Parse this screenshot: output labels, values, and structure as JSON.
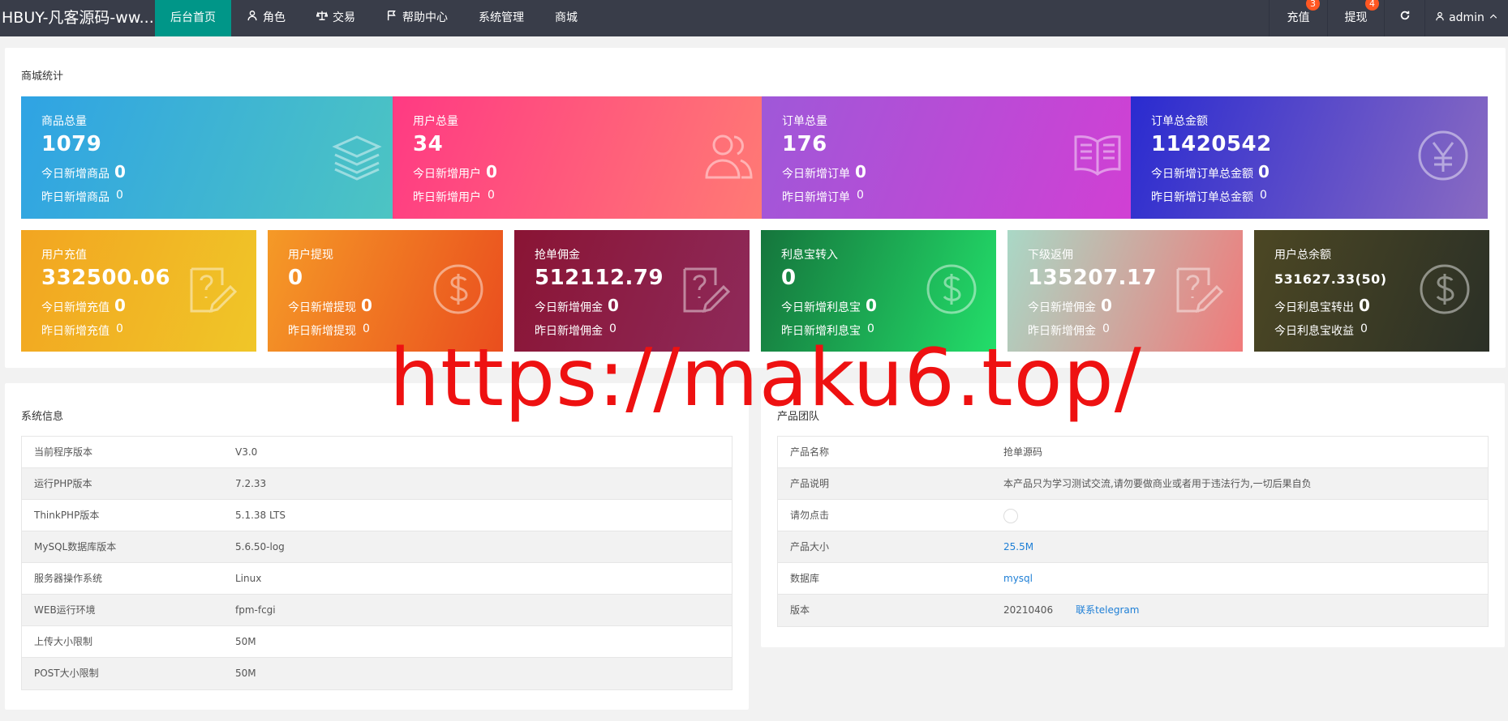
{
  "header": {
    "logo": "HBUY-凡客源码-ww...",
    "nav": [
      {
        "label": "后台首页",
        "icon": "",
        "active": true
      },
      {
        "label": "角色",
        "icon": "user-icon"
      },
      {
        "label": "交易",
        "icon": "scale-icon"
      },
      {
        "label": "帮助中心",
        "icon": "flag-icon"
      },
      {
        "label": "系统管理",
        "icon": ""
      },
      {
        "label": "商城",
        "icon": ""
      }
    ],
    "right": {
      "recharge": {
        "label": "充值",
        "badge": "3"
      },
      "withdraw": {
        "label": "提现",
        "badge": "4"
      },
      "refresh_icon": "refresh-icon",
      "user": {
        "label": "admin",
        "icon": "user-icon",
        "caret": "chevron-up-icon"
      }
    }
  },
  "stats": {
    "title": "商城统计",
    "cards": [
      {
        "label": "商品总量",
        "value": "1079",
        "today_label": "今日新增商品",
        "today": "0",
        "yesterday_label": "昨日新增商品",
        "yesterday": "0",
        "icon": "layers-icon",
        "gradient": [
          "#2fa3e4",
          "#4dc5c2"
        ]
      },
      {
        "label": "用户总量",
        "value": "34",
        "today_label": "今日新增用户",
        "today": "0",
        "yesterday_label": "昨日新增用户",
        "yesterday": "0",
        "icon": "users-icon",
        "gradient": [
          "#ff3a83",
          "#ff7c74"
        ]
      },
      {
        "label": "订单总量",
        "value": "176",
        "today_label": "今日新增订单",
        "today": "0",
        "yesterday_label": "昨日新增订单",
        "yesterday": "0",
        "icon": "book-icon",
        "gradient": [
          "#9f58d8",
          "#d23fd4"
        ]
      },
      {
        "label": "订单总金额",
        "value": "11420542",
        "today_label": "今日新增订单总金额",
        "today": "0",
        "yesterday_label": "昨日新增订单总金额",
        "yesterday": "0",
        "icon": "yen-icon",
        "gradient": [
          "#2a2bd0",
          "#8a6bc2"
        ]
      },
      {
        "label": "用户充值",
        "value": "332500.06",
        "today_label": "今日新增充值",
        "today": "0",
        "yesterday_label": "昨日新增充值",
        "yesterday": "0",
        "icon": "question-edit-icon",
        "gradient": [
          "#f2a521",
          "#f0c628"
        ]
      },
      {
        "label": "用户提现",
        "value": "0",
        "today_label": "今日新增提现",
        "today": "0",
        "yesterday_label": "昨日新增提现",
        "yesterday": "0",
        "icon": "dollar-icon",
        "gradient": [
          "#f59a27",
          "#ea4e1e"
        ]
      },
      {
        "label": "抢单佣金",
        "value": "512112.79",
        "today_label": "今日新增佣金",
        "today": "0",
        "yesterday_label": "昨日新增佣金",
        "yesterday": "0",
        "icon": "question-edit-icon",
        "gradient": [
          "#8a1434",
          "#8e2a5a"
        ]
      },
      {
        "label": "利息宝转入",
        "value": "0",
        "today_label": "今日新增利息宝",
        "today": "0",
        "yesterday_label": "昨日新增利息宝",
        "yesterday": "0",
        "icon": "dollar-icon",
        "gradient": [
          "#15753c",
          "#23de6a"
        ]
      },
      {
        "label": "下级返佣",
        "value": "135207.17",
        "today_label": "今日新增佣金",
        "today": "0",
        "yesterday_label": "昨日新增佣金",
        "yesterday": "0",
        "icon": "question-edit-icon",
        "gradient": [
          "#a9d8c6",
          "#f07a7a"
        ]
      },
      {
        "label": "用户总余额",
        "value": "531627.33(50)",
        "today_label": "今日利息宝转出",
        "today": "0",
        "yesterday_label": "今日利息宝收益",
        "yesterday": "0",
        "icon": "dollar-icon",
        "gradient": [
          "#4c4724",
          "#2b3026"
        ],
        "small": true
      }
    ]
  },
  "system": {
    "title": "系统信息",
    "rows": [
      {
        "k": "当前程序版本",
        "v": "V3.0"
      },
      {
        "k": "运行PHP版本",
        "v": "7.2.33"
      },
      {
        "k": "ThinkPHP版本",
        "v": "5.1.38 LTS"
      },
      {
        "k": "MySQL数据库版本",
        "v": "5.6.50-log"
      },
      {
        "k": "服务器操作系统",
        "v": "Linux"
      },
      {
        "k": "WEB运行环境",
        "v": "fpm-fcgi"
      },
      {
        "k": "上传大小限制",
        "v": "50M"
      },
      {
        "k": "POST大小限制",
        "v": "50M"
      }
    ]
  },
  "product": {
    "title": "产品团队",
    "rows": [
      {
        "k": "产品名称",
        "v": "抢单源码"
      },
      {
        "k": "产品说明",
        "v": "本产品只为学习测试交流,请勿要做商业或者用于违法行为,一切后果自负"
      },
      {
        "k": "请勿点击",
        "v": "",
        "badge_icon": "circle-badge-icon"
      },
      {
        "k": "产品大小",
        "v": "25.5M",
        "link": true
      },
      {
        "k": "数据库",
        "v": "mysql",
        "link": true
      },
      {
        "k": "版本",
        "v": "20210406",
        "extra": "联系telegram"
      }
    ]
  },
  "watermark": "https://maku6.top/"
}
